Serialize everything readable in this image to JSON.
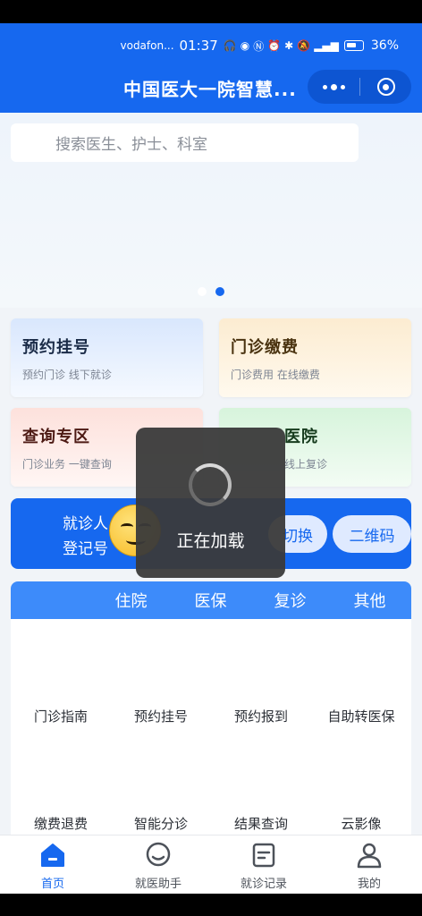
{
  "status_bar": {
    "carrier": "vodafon...",
    "time": "01:37",
    "battery": "36%"
  },
  "header": {
    "title": "中国医大一院智慧..."
  },
  "search": {
    "placeholder": "搜索医生、护士、科室"
  },
  "quick_cards": [
    {
      "title": "预约挂号",
      "subtitle": "预约门诊 线下就诊"
    },
    {
      "title": "门诊缴费",
      "subtitle": "门诊费用 在线缴费"
    },
    {
      "title": "查询专区",
      "subtitle": "门诊业务 一键查询"
    },
    {
      "title": "医院",
      "subtitle": "线上复诊"
    }
  ],
  "patient_bar": {
    "line1": "就诊人",
    "line2": "登记号",
    "switch_label": "切换",
    "qr_label": "二维码"
  },
  "service_tabs": [
    "住院",
    "医保",
    "复诊",
    "其他"
  ],
  "service_grid": [
    "门诊指南",
    "预约挂号",
    "预约报到",
    "自助转医保",
    "缴费退费",
    "智能分诊",
    "结果查询",
    "云影像"
  ],
  "loading": {
    "text": "正在加载"
  },
  "bottom_nav": [
    {
      "label": "首页",
      "icon": "home-icon",
      "active": true
    },
    {
      "label": "就医助手",
      "icon": "chat-bubble-icon",
      "active": false
    },
    {
      "label": "就诊记录",
      "icon": "document-icon",
      "active": false
    },
    {
      "label": "我的",
      "icon": "user-icon",
      "active": false
    }
  ],
  "colors": {
    "primary": "#1668ef",
    "tab_bar": "#3d8bfa",
    "toast_bg": "#3a3a3a"
  }
}
